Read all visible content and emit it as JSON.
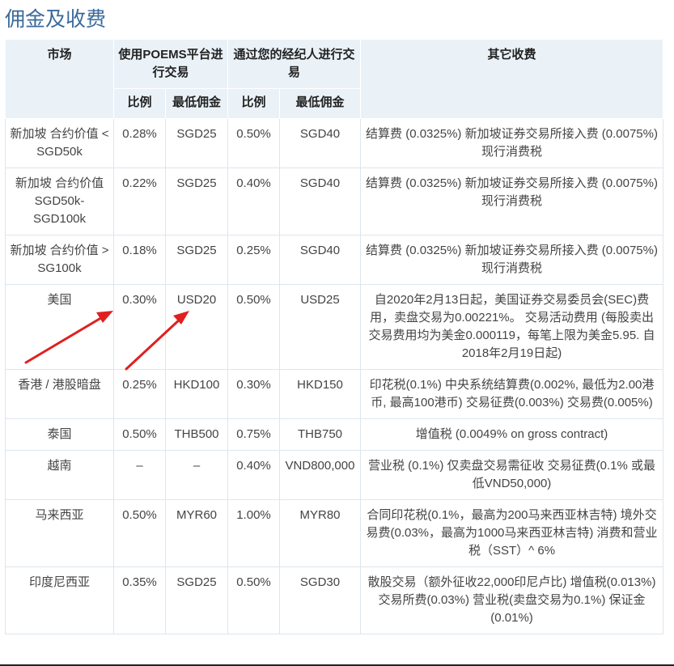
{
  "page": {
    "title": "佣金及收费"
  },
  "headers": {
    "market": "市场",
    "poems": "使用POEMS平台进行交易",
    "broker": "通过您的经纪人进行交易",
    "other": "其它收费",
    "rate": "比例",
    "min": "最低佣金"
  },
  "rows": [
    {
      "market": "新加坡 合约价值 < SGD50k",
      "p_rate": "0.28%",
      "p_min": "SGD25",
      "b_rate": "0.50%",
      "b_min": "SGD40",
      "other": "结算费 (0.0325%) 新加坡证券交易所接入费 (0.0075%) 现行消费税"
    },
    {
      "market": "新加坡 合约价值 SGD50k-SGD100k",
      "p_rate": "0.22%",
      "p_min": "SGD25",
      "b_rate": "0.40%",
      "b_min": "SGD40",
      "other": "结算费 (0.0325%) 新加坡证券交易所接入费 (0.0075%) 现行消费税"
    },
    {
      "market": "新加坡 合约价值 > SG100k",
      "p_rate": "0.18%",
      "p_min": "SGD25",
      "b_rate": "0.25%",
      "b_min": "SGD40",
      "other": "结算费 (0.0325%) 新加坡证券交易所接入费 (0.0075%) 现行消费税"
    },
    {
      "market": "美国",
      "p_rate": "0.30%",
      "p_min": "USD20",
      "b_rate": "0.50%",
      "b_min": "USD25",
      "other": "自2020年2月13日起，美国证券交易委员会(SEC)费用，卖盘交易为0.00221%。 交易活动费用 (每股卖出交易费用均为美金0.000119，每笔上限为美金5.95. 自2018年2月19日起)"
    },
    {
      "market": "香港 / 港股暗盘",
      "p_rate": "0.25%",
      "p_min": "HKD100",
      "b_rate": "0.30%",
      "b_min": "HKD150",
      "other": "印花税(0.1%) 中央系统结算费(0.002%, 最低为2.00港币, 最高100港币) 交易征费(0.003%) 交易费(0.005%)"
    },
    {
      "market": "泰国",
      "p_rate": "0.50%",
      "p_min": "THB500",
      "b_rate": "0.75%",
      "b_min": "THB750",
      "other": "增值税 (0.0049% on gross contract)"
    },
    {
      "market": "越南",
      "p_rate": "–",
      "p_min": "–",
      "b_rate": "0.40%",
      "b_min": "VND800,000",
      "other": "营业税 (0.1%) 仅卖盘交易需征收 交易征费(0.1% 或最低VND50,000)"
    },
    {
      "market": "马来西亚",
      "p_rate": "0.50%",
      "p_min": "MYR60",
      "b_rate": "1.00%",
      "b_min": "MYR80",
      "other": "合同印花税(0.1%，最高为200马来西亚林吉特) 境外交易费(0.03%，最高为1000马来西亚林吉特) 消费和营业税（SST）^ 6%"
    },
    {
      "market": "印度尼西亚",
      "p_rate": "0.35%",
      "p_min": "SGD25",
      "b_rate": "0.50%",
      "b_min": "SGD30",
      "other": "散股交易（额外征收22,000印尼卢比) 增值税(0.013%) 交易所费(0.03%) 营业税(卖盘交易为0.1%) 保证金(0.01%)"
    }
  ],
  "colors": {
    "title": "#3a6a9c",
    "header_bg": "#eaf2f8",
    "arrow": "#e02020"
  }
}
